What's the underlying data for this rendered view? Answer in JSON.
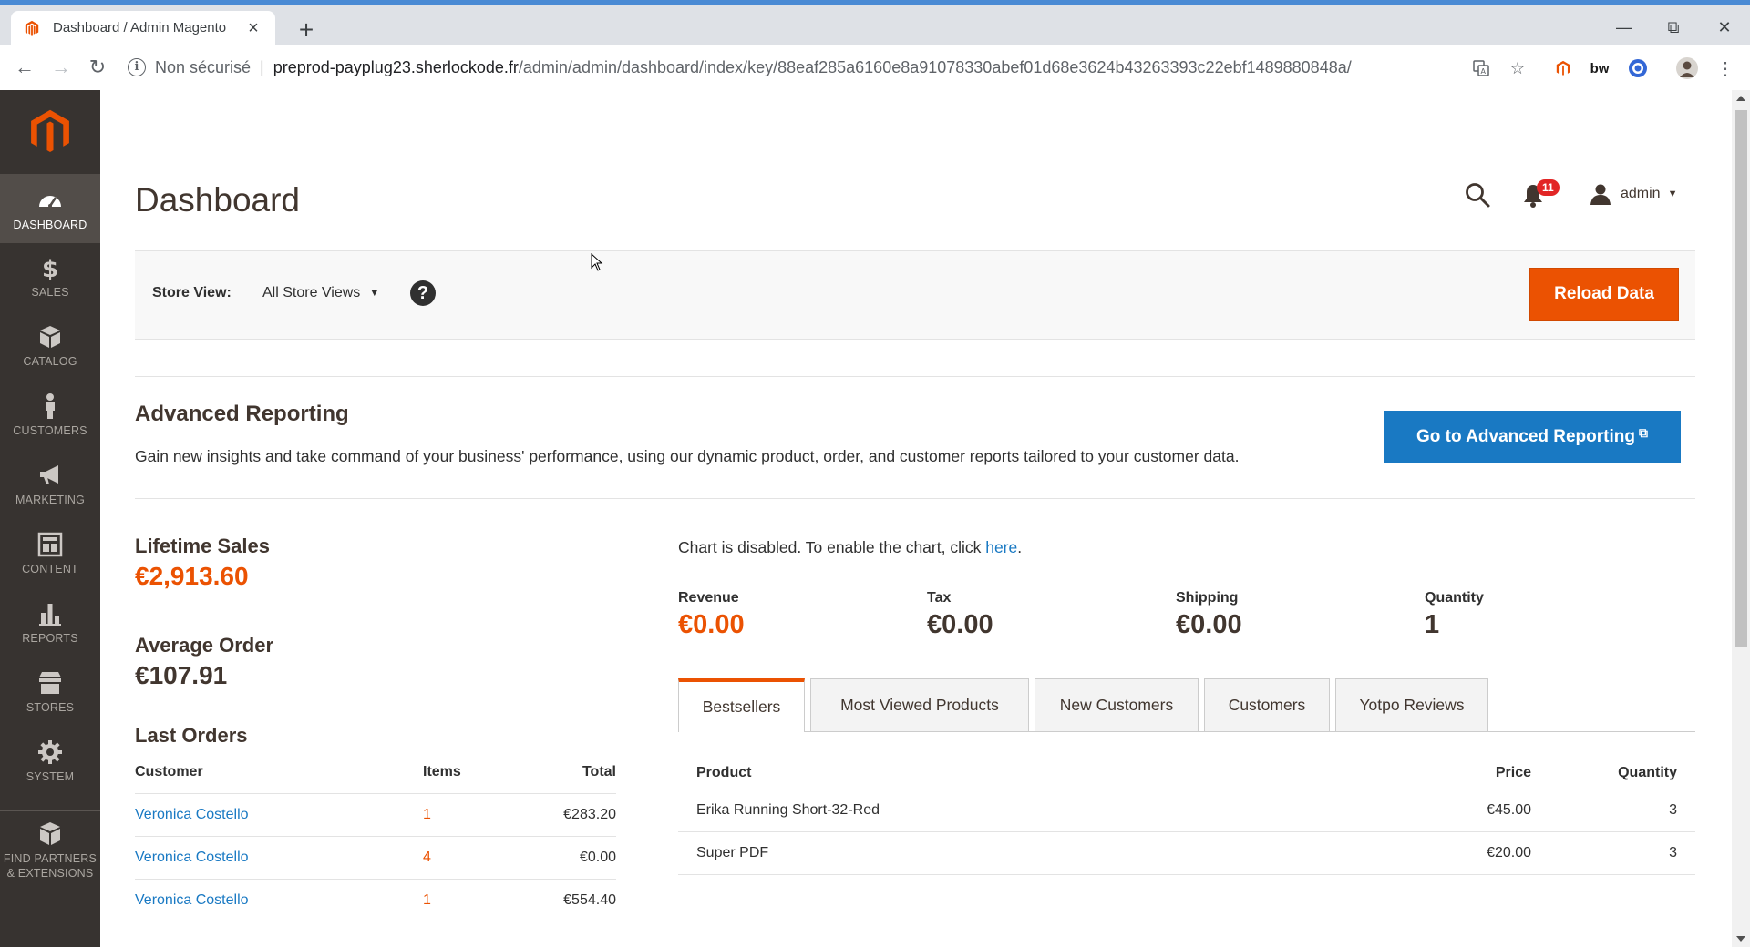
{
  "browser": {
    "tab_title": "Dashboard / Admin Magento",
    "not_secure": "Non sécurisé",
    "url_host": "preprod-payplug23.sherlockode.fr",
    "url_path": "/admin/admin/dashboard/index/key/88eaf285a6160e8a91078330abef01d68e3624b43263393c22ebf1489880848a/"
  },
  "sidebar": {
    "items": [
      {
        "label": "Dashboard",
        "icon": "dashboard-icon"
      },
      {
        "label": "Sales",
        "icon": "dollar-icon"
      },
      {
        "label": "Catalog",
        "icon": "box-icon"
      },
      {
        "label": "Customers",
        "icon": "person-icon"
      },
      {
        "label": "Marketing",
        "icon": "megaphone-icon"
      },
      {
        "label": "Content",
        "icon": "layout-icon"
      },
      {
        "label": "Reports",
        "icon": "bar-chart-icon"
      },
      {
        "label": "Stores",
        "icon": "store-icon"
      },
      {
        "label": "System",
        "icon": "gear-icon"
      }
    ],
    "partners_line1": "Find Partners",
    "partners_line2": "& Extensions"
  },
  "header": {
    "title": "Dashboard",
    "notifications": "11",
    "user": "admin"
  },
  "store_bar": {
    "label": "Store View:",
    "selected": "All Store Views",
    "help": "?",
    "reload": "Reload Data"
  },
  "advanced_reporting": {
    "title": "Advanced Reporting",
    "description": "Gain new insights and take command of your business' performance, using our dynamic product, order, and customer reports tailored to your customer data.",
    "button": "Go to Advanced Reporting"
  },
  "stats": {
    "lifetime_label": "Lifetime Sales",
    "lifetime_value": "€2,913.60",
    "avg_label": "Average Order",
    "avg_value": "€107.91"
  },
  "last_orders": {
    "title": "Last Orders",
    "headers": [
      "Customer",
      "Items",
      "Total"
    ],
    "rows": [
      {
        "customer": "Veronica Costello",
        "items": "1",
        "total": "€283.20"
      },
      {
        "customer": "Veronica Costello",
        "items": "4",
        "total": "€0.00"
      },
      {
        "customer": "Veronica Costello",
        "items": "1",
        "total": "€554.40"
      }
    ]
  },
  "chart": {
    "msg_prefix": "Chart is disabled. To enable the chart, click ",
    "msg_link": "here",
    "msg_suffix": "."
  },
  "totals": [
    {
      "label": "Revenue",
      "value": "€0.00"
    },
    {
      "label": "Tax",
      "value": "€0.00"
    },
    {
      "label": "Shipping",
      "value": "€0.00"
    },
    {
      "label": "Quantity",
      "value": "1"
    }
  ],
  "tabs": [
    "Bestsellers",
    "Most Viewed Products",
    "New Customers",
    "Customers",
    "Yotpo Reviews"
  ],
  "bestsellers": {
    "headers": [
      "Product",
      "Price",
      "Quantity"
    ],
    "rows": [
      {
        "product": "Erika Running Short-32-Red",
        "price": "€45.00",
        "qty": "3"
      },
      {
        "product": "Super PDF",
        "price": "€20.00",
        "qty": "3"
      }
    ]
  },
  "colors": {
    "accent": "#eb5202",
    "link": "#1979c3",
    "sidebar": "#373330"
  }
}
